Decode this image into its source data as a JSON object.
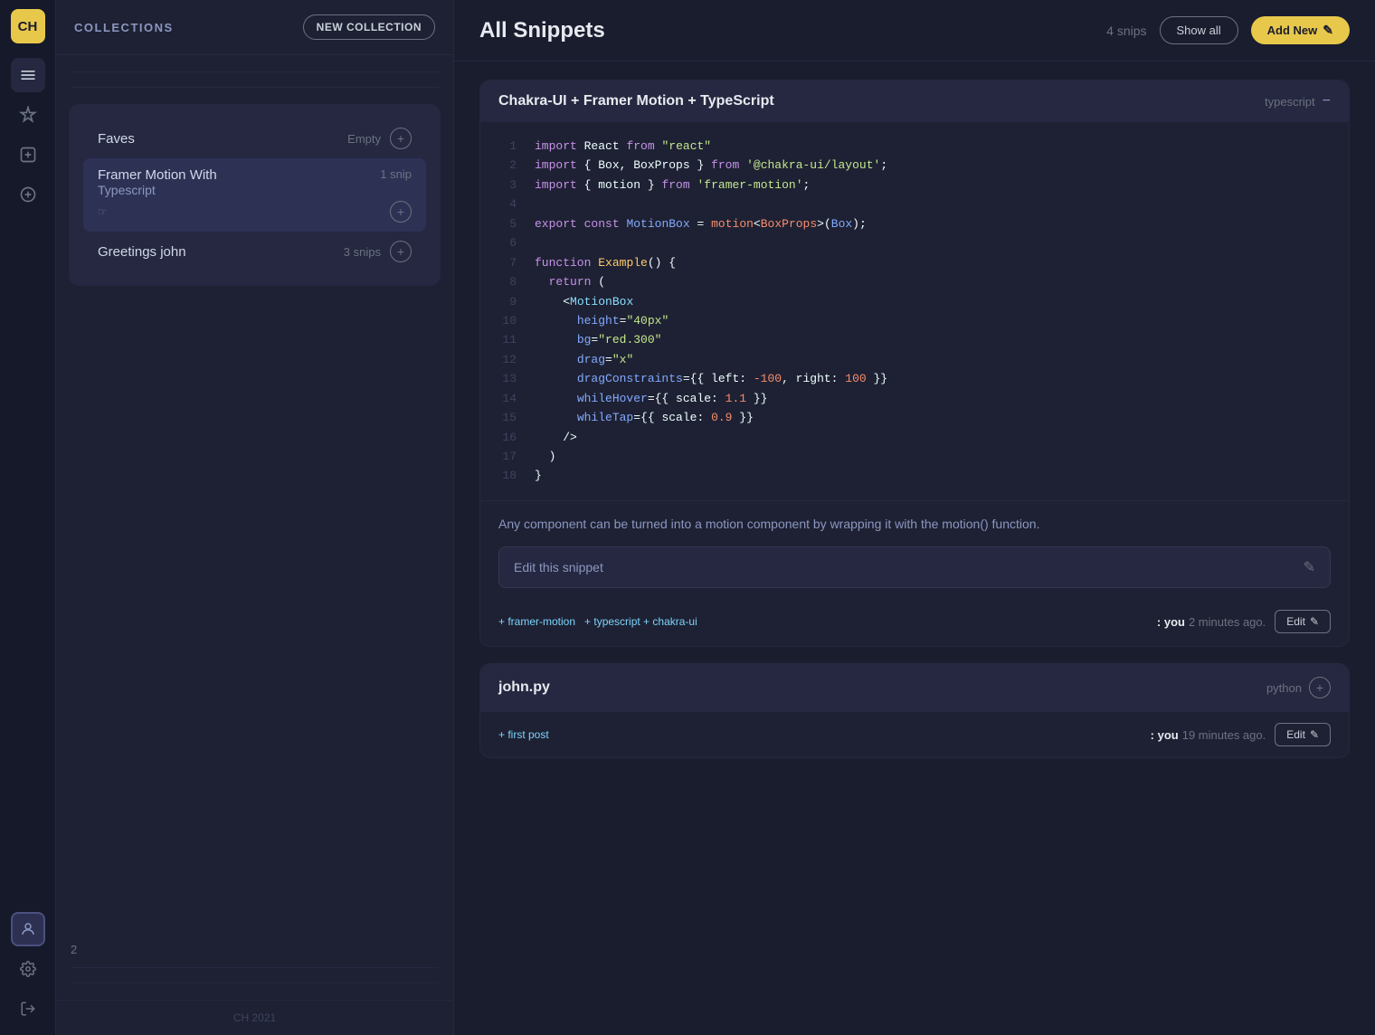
{
  "sidebar": {
    "logo": "CH",
    "icons": [
      {
        "name": "folder-icon",
        "glyph": "🗂",
        "active": true
      },
      {
        "name": "sparkle-icon",
        "glyph": "✦"
      },
      {
        "name": "plus-square-icon",
        "glyph": "⊞"
      },
      {
        "name": "plus-circle-icon",
        "glyph": "⊕"
      }
    ],
    "bottom_icons": [
      {
        "name": "user-icon",
        "glyph": "👤",
        "active": true
      },
      {
        "name": "settings-icon",
        "glyph": "⚙"
      },
      {
        "name": "logout-icon",
        "glyph": "⬡"
      }
    ]
  },
  "collections": {
    "title": "COLLECTIONS",
    "new_collection_label": "NEW COLLECTION",
    "items": [
      {
        "name": "Faves",
        "count": "",
        "count_label": "Empty",
        "id": "faves"
      },
      {
        "name": "Framer Motion With\nTypescript",
        "count": "1 snip",
        "id": "framer",
        "selected": true
      },
      {
        "name": "Greetings john",
        "count": "3 snips",
        "id": "greetings"
      }
    ],
    "page_num": "2",
    "footer": "CH 2021"
  },
  "main": {
    "title": "All Snippets",
    "snips_count": "4 snips",
    "show_all_label": "Show all",
    "add_new_label": "Add New",
    "snippets": [
      {
        "id": "chakra-snippet",
        "title": "Chakra-UI + Framer Motion + TypeScript",
        "language": "typescript",
        "code_lines": [
          {
            "num": 1,
            "html": "<span class='c-keyword'>import</span> <span class='c-white'>React</span> <span class='c-keyword'>from</span> <span class='c-string'>\"react\"</span>"
          },
          {
            "num": 2,
            "html": "<span class='c-keyword'>import</span> <span class='c-white'>{ Box, BoxProps }</span> <span class='c-keyword'>from</span> <span class='c-string'>'@chakra-ui/layout'</span><span class='c-white'>;</span>"
          },
          {
            "num": 3,
            "html": "<span class='c-keyword'>import</span> <span class='c-white'>{ motion }</span> <span class='c-keyword'>from</span> <span class='c-string'>'framer-motion'</span><span class='c-white'>;</span>"
          },
          {
            "num": 4,
            "html": ""
          },
          {
            "num": 5,
            "html": "<span class='c-keyword'>export</span> <span class='c-keyword'>const</span> <span class='c-blue'>MotionBox</span> <span class='c-white'>=</span> <span class='c-orange'>motion</span><span class='c-white'>&lt;</span><span class='c-orange'>BoxProps</span><span class='c-white'>&gt;(</span><span class='c-blue'>Box</span><span class='c-white'>);</span>"
          },
          {
            "num": 6,
            "html": ""
          },
          {
            "num": 7,
            "html": "<span class='c-keyword'>function</span> <span class='c-yellow'>Example</span><span class='c-white'>() {</span>"
          },
          {
            "num": 8,
            "html": "  <span class='c-keyword'>return</span> <span class='c-white'>(</span>"
          },
          {
            "num": 9,
            "html": "    <span class='c-white'>&lt;</span><span class='c-teal'>MotionBox</span>"
          },
          {
            "num": 10,
            "html": "      <span class='c-blue'>height</span><span class='c-white'>=</span><span class='c-string'>\"40px\"</span>"
          },
          {
            "num": 11,
            "html": "      <span class='c-blue'>bg</span><span class='c-white'>=</span><span class='c-string'>\"red.300\"</span>"
          },
          {
            "num": 12,
            "html": "      <span class='c-blue'>drag</span><span class='c-white'>=</span><span class='c-string'>\"x\"</span>"
          },
          {
            "num": 13,
            "html": "      <span class='c-blue'>dragConstraints</span><span class='c-white'>={{ left: </span><span class='c-orange'>-100</span><span class='c-white'>, right: </span><span class='c-orange'>100</span><span class='c-white'> }}"
          },
          {
            "num": 14,
            "html": "      <span class='c-blue'>whileHover</span><span class='c-white'>={{ scale: </span><span class='c-orange'>1.1</span><span class='c-white'> }}"
          },
          {
            "num": 15,
            "html": "      <span class='c-blue'>whileTap</span><span class='c-white'>={{ scale: </span><span class='c-orange'>0.9</span><span class='c-white'> }}"
          },
          {
            "num": 16,
            "html": "    <span class='c-white'>/&gt;</span>"
          },
          {
            "num": 17,
            "html": "  <span class='c-white'>)</span>"
          },
          {
            "num": 18,
            "html": "<span class='c-white'>}</span>"
          }
        ],
        "description": "Any component can be turned into a motion component by wrapping it with the motion() function.",
        "edit_label": "Edit this snippet",
        "tags": [
          "+ framer-motion",
          "+ typescript + chakra-ui"
        ],
        "meta_you": ": you",
        "meta_time": "2 minutes ago.",
        "edit_btn_label": "Edit"
      },
      {
        "id": "john-py",
        "title": "john.py",
        "language": "python",
        "tags": [
          "+ first post"
        ],
        "meta_you": ": you",
        "meta_time": "19 minutes ago.",
        "edit_btn_label": "Edit"
      }
    ]
  }
}
